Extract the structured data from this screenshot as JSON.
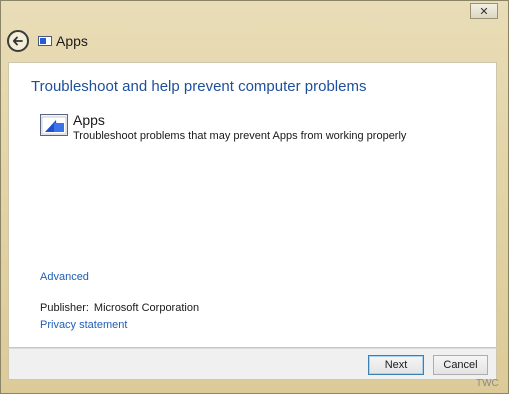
{
  "window": {
    "close_glyph": "✕",
    "title": "Apps"
  },
  "main": {
    "heading": "Troubleshoot and help prevent computer problems",
    "troubleshooter": {
      "title": "Apps",
      "description": "Troubleshoot problems that may prevent Apps from working properly",
      "icon": "apps-troubleshooter-icon"
    },
    "advanced_link": "Advanced",
    "publisher_label": "Publisher:",
    "publisher_value": "Microsoft Corporation",
    "privacy_link": "Privacy statement"
  },
  "footer": {
    "next_label": "Next",
    "cancel_label": "Cancel"
  },
  "watermark": "TWC",
  "colors": {
    "heading": "#1d4f9c",
    "link": "#1f5fb4",
    "frame": "#e3d5a8"
  }
}
